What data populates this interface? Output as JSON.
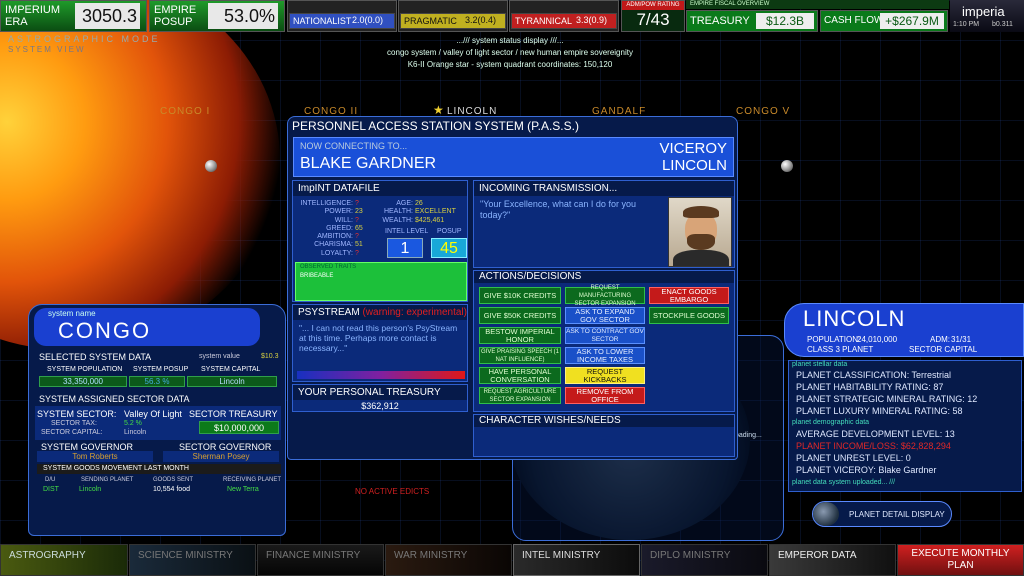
{
  "top": {
    "imperium_era": {
      "label": "IMPERIUM ERA",
      "value": "3050.3"
    },
    "empire_posup": {
      "label": "EMPIRE POSUP",
      "value": "53.0%"
    },
    "nationalist": {
      "label": "NATIONALIST",
      "value": "2.0(0.0)",
      "color": "#3050c0"
    },
    "pragmatic": {
      "label": "PRAGMATIC",
      "value": "3.2(0.4)",
      "color": "#c0b020"
    },
    "tyrannical": {
      "label": "TYRANNICAL",
      "value": "3.3(0.9)",
      "color": "#c02020"
    },
    "adm_pow": {
      "label": "ADM/POW RATING",
      "value": "7/43"
    },
    "fiscal_title": "EMPIRE FISCAL OVERVIEW",
    "treasury": {
      "label": "TREASURY",
      "value": "$12.3B"
    },
    "cash_flow": {
      "label": "CASH FLOW",
      "value": "+$267.9M"
    },
    "logo": "imperia",
    "clock": "1:10 PM",
    "version": "b0.311",
    "mode_title": "ASTROGRAPHIC MODE",
    "mode_sub": "SYSTEM VIEW",
    "status_line1": ".../// system status display ///...",
    "status_line2": "congo system / valley of light sector / new human empire sovereignity",
    "status_line3": "K6-II Orange star - system quadrant coordinates: 150,120"
  },
  "system_planets": [
    "CONGO I",
    "CONGO II",
    "LINCOLN",
    "GANDALF",
    "CONGO V"
  ],
  "pass": {
    "title": "PERSONNEL ACCESS STATION SYSTEM (P.A.S.S.)",
    "connecting": "NOW CONNECTING TO...",
    "name": "BLAKE GARDNER",
    "role_line1": "VICEROY",
    "role_line2": "LINCOLN",
    "datafile_title": "ImpINT DATAFILE",
    "stats_left": [
      {
        "label": "INTELLIGENCE:",
        "value": "?"
      },
      {
        "label": "POWER:",
        "value": "23"
      },
      {
        "label": "WILL:",
        "value": "?"
      },
      {
        "label": "GREED:",
        "value": "65"
      },
      {
        "label": "AMBITION:",
        "value": "?"
      },
      {
        "label": "CHARISMA:",
        "value": "51"
      },
      {
        "label": "LOYALTY:",
        "value": "?"
      }
    ],
    "stats_right": [
      {
        "label": "AGE:",
        "value": "26"
      },
      {
        "label": "HEALTH:",
        "value": "EXCELLENT"
      },
      {
        "label": "WEALTH:",
        "value": "$425,461"
      }
    ],
    "intel_label": "INTEL LEVEL",
    "intel_value": "1",
    "posup_label": "POSUP",
    "posup_value": "45",
    "traits_title": "OBSERVED TRAITS",
    "traits": [
      "BRIBEABLE"
    ],
    "psystream_title": "PSYSTREAM",
    "psystream_warning": "(warning: experimental)",
    "psystream_text": "\"... I can not read this person's PsyStream at this time. Perhaps more contact is necessary...\"",
    "treasury_title": "YOUR PERSONAL TREASURY",
    "treasury_value": "$362,912",
    "transmission_title": "INCOMING TRANSMISSION...",
    "transmission_text": "\"Your Excellence, what can I do for you today?\"",
    "actions_title": "ACTIONS/DECISIONS",
    "actions": {
      "give10k": "GIVE $10K CREDITS",
      "give50k": "GIVE $50K CREDITS",
      "bestow": "BESTOW IMPERIAL HONOR",
      "praising": "GIVE PRAISING SPEECH (1 NAT INFLUENCE)",
      "conversation": "HAVE PERSONAL CONVERSATION",
      "agri": "REQUEST AGRICULTURE SECTOR EXPANSION",
      "manufacturing": "REQUEST MANUFACTURING SECTOR EXPANSION",
      "expand_gov": "ASK TO EXPAND GOV SECTOR",
      "contract_gov": "ASK TO CONTRACT GOV SECTOR",
      "lower_tax": "ASK TO LOWER INCOME TAXES",
      "kickbacks": "REQUEST KICKBACKS",
      "remove": "REMOVE FROM OFFICE",
      "embargo": "ENACT GOODS EMBARGO",
      "stockpile": "STOCKPILE GOODS"
    },
    "wishes_title": "CHARACTER WISHES/NEEDS"
  },
  "system": {
    "name_label": "system name",
    "name": "CONGO",
    "selected_title": "SELECTED SYSTEM DATA",
    "system_value_label": "system value",
    "system_value": "$10.3",
    "pop_label": "SYSTEM POPULATION",
    "pop_value": "33,350,000",
    "posup_label": "SYSTEM POSUP",
    "posup_value": "56.3 %",
    "capital_label": "SYSTEM CAPITAL",
    "capital_value": "Lincoln",
    "sector_title": "SYSTEM ASSIGNED SECTOR DATA",
    "sector_label": "SYSTEM SECTOR:",
    "sector_value": "Valley Of Light",
    "sector_tax_label": "SECTOR TAX:",
    "sector_tax_value": "5.2 %",
    "sector_capital_label": "SECTOR CAPITAL:",
    "sector_capital_value": "Lincoln",
    "sector_treasury_label": "SECTOR TREASURY",
    "sector_treasury_value": "$10,000,000",
    "sys_gov_label": "SYSTEM GOVERNOR",
    "sys_gov_value": "Tom Roberts",
    "sec_gov_label": "SECTOR GOVERNOR",
    "sec_gov_value": "Sherman Posey",
    "goods_title": "SYSTEM GOODS MOVEMENT LAST MONTH",
    "goods_headers": [
      "D/U",
      "SENDING PLANET",
      "GOODS SENT",
      "RECEIVING PLANET"
    ],
    "goods_row": [
      "DIST",
      "Lincoln",
      "10,554 food",
      "New Terra"
    ],
    "no_edicts": "NO ACTIVE EDICTS"
  },
  "planet": {
    "name": "LINCOLN",
    "population_label": "POPULATION:",
    "population_value": "24,010,000",
    "adm_label": "ADM:",
    "adm_value": "31/31",
    "class": "CLASS 3 PLANET",
    "sector_capital": "SECTOR CAPITAL",
    "stellar_title": "planet stellar data",
    "stellar": [
      "PLANET CLASSIFICATION: Terrestrial",
      "PLANET HABITABILITY RATING: 87",
      "PLANET STRATEGIC MINERAL RATING: 12",
      "PLANET LUXURY MINERAL RATING: 58"
    ],
    "demo_title": "planet demographic data",
    "demo": [
      "AVERAGE DEVELOPMENT LEVEL: 13",
      "PLANET INCOME/LOSS: $62,828,294",
      "PLANET UNREST LEVEL: 0",
      "PLANET VICEROY: Blake Gardner"
    ],
    "uploaded": "planet data system uploaded... ///",
    "detail_button": "PLANET DETAIL DISPLAY",
    "loading_text": "oading..."
  },
  "nav": {
    "astrography": "ASTROGRAPHY",
    "science": "SCIENCE MINISTRY",
    "finance": "FINANCE MINISTRY",
    "war": "WAR MINISTRY",
    "intel": "INTEL MINISTRY",
    "diplo": "DIPLO MINISTRY",
    "emperor": "EMPEROR DATA",
    "execute": "EXECUTE MONTHLY PLAN"
  }
}
